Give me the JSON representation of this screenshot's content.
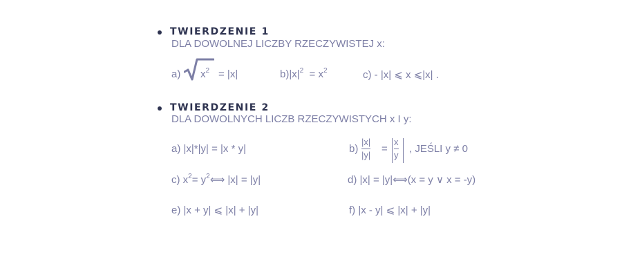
{
  "theorem1": {
    "title": "TWIERDZENIE 1",
    "subtitle": "DLA DOWOLNEJ LICZBY RZECZYWISTEJ x:",
    "a_label": "a)",
    "a_radicand": "x",
    "a_exp": "2",
    "a_rhs": "=  |x|",
    "b_label": "b)",
    "b_lhs": "|x|",
    "b_exp": "2",
    "b_eq": "=  x",
    "b_exp2": "2",
    "c_expr": "c)  - |x|  ⩽  x  ⩽|x| ."
  },
  "theorem2": {
    "title": "TWIERDZENIE 2",
    "subtitle": "DLA DOWOLNYCH LICZB RZECZYWISTYCH x I y:",
    "a_expr": "a) |x|*|y|  =  |x * y|",
    "b_label": "b)",
    "b_num": "|x|",
    "b_den": "|y|",
    "b_eq": "=",
    "b_num2": "x",
    "b_den2": "y",
    "b_cond": ", JEŚLI y ≠ 0",
    "c_pre": "c) x",
    "c_exp1": "2",
    "c_mid": "= y",
    "c_exp2": "2",
    "c_post": "⟺  |x| = |y|",
    "d_expr": "d) |x|  = |y|⟺(x = y  ∨  x = -y)",
    "e_expr": "e) |x + y|  ⩽ |x| + |y|",
    "f_expr": "f)  |x - y|  ⩽ |x|  +  |y|"
  }
}
